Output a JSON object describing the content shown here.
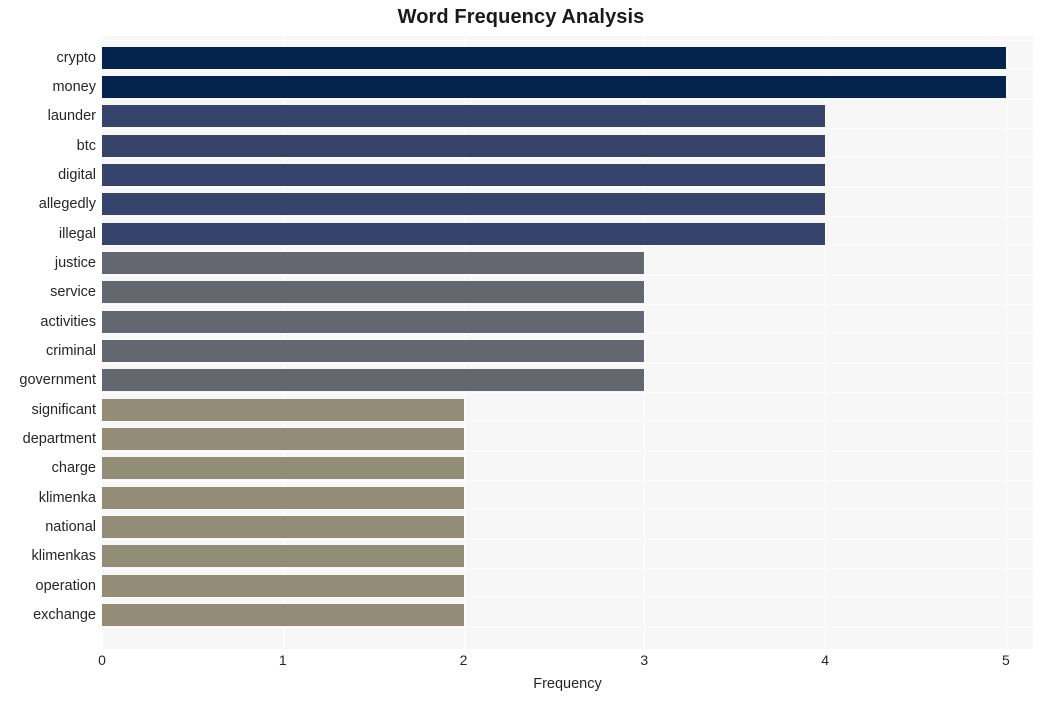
{
  "chart_data": {
    "type": "bar",
    "orientation": "horizontal",
    "title": "Word Frequency Analysis",
    "xlabel": "Frequency",
    "ylabel": "",
    "xlim": [
      0,
      5.15
    ],
    "xticks": [
      0,
      1,
      2,
      3,
      4,
      5
    ],
    "xtick_labels": [
      "0",
      "1",
      "2",
      "3",
      "4",
      "5"
    ],
    "grid": "vertical-white-on-light-gray",
    "legend": "none",
    "categories": [
      "crypto",
      "money",
      "launder",
      "btc",
      "digital",
      "allegedly",
      "illegal",
      "justice",
      "service",
      "activities",
      "criminal",
      "government",
      "significant",
      "department",
      "charge",
      "klimenka",
      "national",
      "klimenkas",
      "operation",
      "exchange"
    ],
    "values": [
      5,
      5,
      4,
      4,
      4,
      4,
      4,
      3,
      3,
      3,
      3,
      3,
      2,
      2,
      2,
      2,
      2,
      2,
      2,
      2
    ],
    "bar_colors": [
      "#04244d",
      "#04244d",
      "#36436b",
      "#36436b",
      "#36436b",
      "#36436b",
      "#36436b",
      "#64676f",
      "#64676f",
      "#64676f",
      "#64676f",
      "#64676f",
      "#938c76",
      "#938c76",
      "#938c76",
      "#938c76",
      "#938c76",
      "#938c76",
      "#938c76",
      "#938c76"
    ],
    "palette": {
      "value_5": "#04244d",
      "value_4": "#36436b",
      "value_3": "#64676f",
      "value_2": "#938c76"
    },
    "plot_background": "#f7f7f7",
    "figure_background": "#ffffff",
    "gridline_color": "#ffffff"
  }
}
